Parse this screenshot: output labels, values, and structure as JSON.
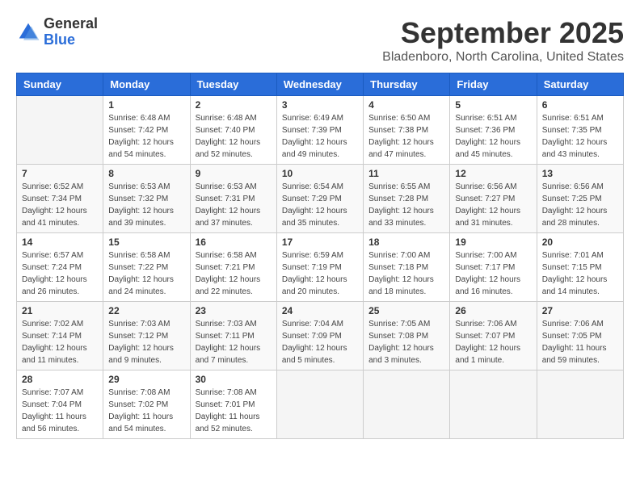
{
  "header": {
    "logo_general": "General",
    "logo_blue": "Blue",
    "month": "September 2025",
    "location": "Bladenboro, North Carolina, United States"
  },
  "days_of_week": [
    "Sunday",
    "Monday",
    "Tuesday",
    "Wednesday",
    "Thursday",
    "Friday",
    "Saturday"
  ],
  "weeks": [
    [
      {
        "day": "",
        "sunrise": "",
        "sunset": "",
        "daylight": ""
      },
      {
        "day": "1",
        "sunrise": "Sunrise: 6:48 AM",
        "sunset": "Sunset: 7:42 PM",
        "daylight": "Daylight: 12 hours and 54 minutes."
      },
      {
        "day": "2",
        "sunrise": "Sunrise: 6:48 AM",
        "sunset": "Sunset: 7:40 PM",
        "daylight": "Daylight: 12 hours and 52 minutes."
      },
      {
        "day": "3",
        "sunrise": "Sunrise: 6:49 AM",
        "sunset": "Sunset: 7:39 PM",
        "daylight": "Daylight: 12 hours and 49 minutes."
      },
      {
        "day": "4",
        "sunrise": "Sunrise: 6:50 AM",
        "sunset": "Sunset: 7:38 PM",
        "daylight": "Daylight: 12 hours and 47 minutes."
      },
      {
        "day": "5",
        "sunrise": "Sunrise: 6:51 AM",
        "sunset": "Sunset: 7:36 PM",
        "daylight": "Daylight: 12 hours and 45 minutes."
      },
      {
        "day": "6",
        "sunrise": "Sunrise: 6:51 AM",
        "sunset": "Sunset: 7:35 PM",
        "daylight": "Daylight: 12 hours and 43 minutes."
      }
    ],
    [
      {
        "day": "7",
        "sunrise": "Sunrise: 6:52 AM",
        "sunset": "Sunset: 7:34 PM",
        "daylight": "Daylight: 12 hours and 41 minutes."
      },
      {
        "day": "8",
        "sunrise": "Sunrise: 6:53 AM",
        "sunset": "Sunset: 7:32 PM",
        "daylight": "Daylight: 12 hours and 39 minutes."
      },
      {
        "day": "9",
        "sunrise": "Sunrise: 6:53 AM",
        "sunset": "Sunset: 7:31 PM",
        "daylight": "Daylight: 12 hours and 37 minutes."
      },
      {
        "day": "10",
        "sunrise": "Sunrise: 6:54 AM",
        "sunset": "Sunset: 7:29 PM",
        "daylight": "Daylight: 12 hours and 35 minutes."
      },
      {
        "day": "11",
        "sunrise": "Sunrise: 6:55 AM",
        "sunset": "Sunset: 7:28 PM",
        "daylight": "Daylight: 12 hours and 33 minutes."
      },
      {
        "day": "12",
        "sunrise": "Sunrise: 6:56 AM",
        "sunset": "Sunset: 7:27 PM",
        "daylight": "Daylight: 12 hours and 31 minutes."
      },
      {
        "day": "13",
        "sunrise": "Sunrise: 6:56 AM",
        "sunset": "Sunset: 7:25 PM",
        "daylight": "Daylight: 12 hours and 28 minutes."
      }
    ],
    [
      {
        "day": "14",
        "sunrise": "Sunrise: 6:57 AM",
        "sunset": "Sunset: 7:24 PM",
        "daylight": "Daylight: 12 hours and 26 minutes."
      },
      {
        "day": "15",
        "sunrise": "Sunrise: 6:58 AM",
        "sunset": "Sunset: 7:22 PM",
        "daylight": "Daylight: 12 hours and 24 minutes."
      },
      {
        "day": "16",
        "sunrise": "Sunrise: 6:58 AM",
        "sunset": "Sunset: 7:21 PM",
        "daylight": "Daylight: 12 hours and 22 minutes."
      },
      {
        "day": "17",
        "sunrise": "Sunrise: 6:59 AM",
        "sunset": "Sunset: 7:19 PM",
        "daylight": "Daylight: 12 hours and 20 minutes."
      },
      {
        "day": "18",
        "sunrise": "Sunrise: 7:00 AM",
        "sunset": "Sunset: 7:18 PM",
        "daylight": "Daylight: 12 hours and 18 minutes."
      },
      {
        "day": "19",
        "sunrise": "Sunrise: 7:00 AM",
        "sunset": "Sunset: 7:17 PM",
        "daylight": "Daylight: 12 hours and 16 minutes."
      },
      {
        "day": "20",
        "sunrise": "Sunrise: 7:01 AM",
        "sunset": "Sunset: 7:15 PM",
        "daylight": "Daylight: 12 hours and 14 minutes."
      }
    ],
    [
      {
        "day": "21",
        "sunrise": "Sunrise: 7:02 AM",
        "sunset": "Sunset: 7:14 PM",
        "daylight": "Daylight: 12 hours and 11 minutes."
      },
      {
        "day": "22",
        "sunrise": "Sunrise: 7:03 AM",
        "sunset": "Sunset: 7:12 PM",
        "daylight": "Daylight: 12 hours and 9 minutes."
      },
      {
        "day": "23",
        "sunrise": "Sunrise: 7:03 AM",
        "sunset": "Sunset: 7:11 PM",
        "daylight": "Daylight: 12 hours and 7 minutes."
      },
      {
        "day": "24",
        "sunrise": "Sunrise: 7:04 AM",
        "sunset": "Sunset: 7:09 PM",
        "daylight": "Daylight: 12 hours and 5 minutes."
      },
      {
        "day": "25",
        "sunrise": "Sunrise: 7:05 AM",
        "sunset": "Sunset: 7:08 PM",
        "daylight": "Daylight: 12 hours and 3 minutes."
      },
      {
        "day": "26",
        "sunrise": "Sunrise: 7:06 AM",
        "sunset": "Sunset: 7:07 PM",
        "daylight": "Daylight: 12 hours and 1 minute."
      },
      {
        "day": "27",
        "sunrise": "Sunrise: 7:06 AM",
        "sunset": "Sunset: 7:05 PM",
        "daylight": "Daylight: 11 hours and 59 minutes."
      }
    ],
    [
      {
        "day": "28",
        "sunrise": "Sunrise: 7:07 AM",
        "sunset": "Sunset: 7:04 PM",
        "daylight": "Daylight: 11 hours and 56 minutes."
      },
      {
        "day": "29",
        "sunrise": "Sunrise: 7:08 AM",
        "sunset": "Sunset: 7:02 PM",
        "daylight": "Daylight: 11 hours and 54 minutes."
      },
      {
        "day": "30",
        "sunrise": "Sunrise: 7:08 AM",
        "sunset": "Sunset: 7:01 PM",
        "daylight": "Daylight: 11 hours and 52 minutes."
      },
      {
        "day": "",
        "sunrise": "",
        "sunset": "",
        "daylight": ""
      },
      {
        "day": "",
        "sunrise": "",
        "sunset": "",
        "daylight": ""
      },
      {
        "day": "",
        "sunrise": "",
        "sunset": "",
        "daylight": ""
      },
      {
        "day": "",
        "sunrise": "",
        "sunset": "",
        "daylight": ""
      }
    ]
  ]
}
